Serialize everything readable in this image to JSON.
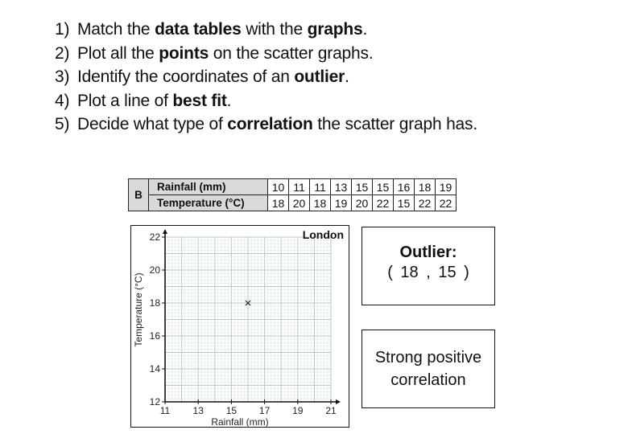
{
  "instructions": [
    {
      "num": "1)",
      "parts": [
        {
          "t": "Match the ",
          "b": false
        },
        {
          "t": "data tables",
          "b": true
        },
        {
          "t": " with the ",
          "b": false
        },
        {
          "t": "graphs",
          "b": true
        },
        {
          "t": ".",
          "b": false
        }
      ]
    },
    {
      "num": "2)",
      "parts": [
        {
          "t": "Plot all the ",
          "b": false
        },
        {
          "t": "points",
          "b": true
        },
        {
          "t": " on the scatter graphs.",
          "b": false
        }
      ]
    },
    {
      "num": "3)",
      "parts": [
        {
          "t": "Identify the coordinates of an ",
          "b": false
        },
        {
          "t": "outlier",
          "b": true
        },
        {
          "t": ".",
          "b": false
        }
      ]
    },
    {
      "num": "4)",
      "parts": [
        {
          "t": "Plot a line of ",
          "b": false
        },
        {
          "t": "best fit",
          "b": true
        },
        {
          "t": ".",
          "b": false
        }
      ]
    },
    {
      "num": "5)",
      "parts": [
        {
          "t": "Decide what type of ",
          "b": false
        },
        {
          "t": "correlation",
          "b": true
        },
        {
          "t": " the scatter graph has.",
          "b": false
        }
      ]
    }
  ],
  "table": {
    "key": "B",
    "rows": [
      {
        "label": "Rainfall (mm)",
        "values": [
          10,
          11,
          11,
          13,
          15,
          15,
          16,
          18,
          19
        ]
      },
      {
        "label": "Temperature (°C)",
        "values": [
          18,
          20,
          18,
          19,
          20,
          22,
          15,
          22,
          22
        ]
      }
    ]
  },
  "chart_data": {
    "type": "scatter",
    "title": "London",
    "xlabel": "Rainfall (mm)",
    "ylabel": "Temperature (°C)",
    "xlim": [
      11,
      21
    ],
    "ylim": [
      12,
      22
    ],
    "xticks": [
      11,
      13,
      15,
      17,
      19,
      21
    ],
    "yticks": [
      12,
      14,
      16,
      18,
      20,
      22
    ],
    "grid": true,
    "points": [
      {
        "x": 16,
        "y": 18,
        "marker": "x"
      }
    ]
  },
  "outlier": {
    "title": "Outlier:",
    "coords": "( 18 , 15 )"
  },
  "correlation": {
    "line1": "Strong positive",
    "line2": "correlation"
  }
}
